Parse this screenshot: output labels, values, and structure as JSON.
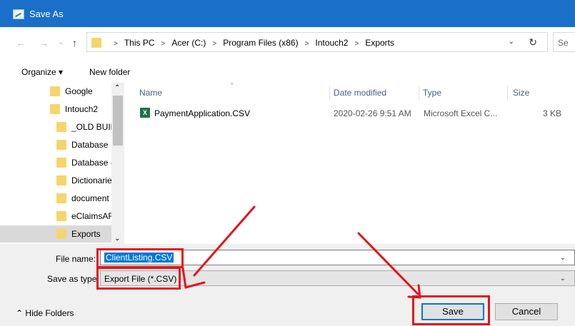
{
  "window": {
    "title": "Save As"
  },
  "address": {
    "crumbs": [
      "This PC",
      "Acer (C:)",
      "Program Files (x86)",
      "Intouch2",
      "Exports"
    ],
    "search_placeholder": "Se"
  },
  "toolbar": {
    "organize_label": "Organize ▾",
    "new_folder_label": "New folder"
  },
  "nav_pane": {
    "items": [
      {
        "label": "Google"
      },
      {
        "label": "Intouch2"
      },
      {
        "label": "_OLD BUIL"
      },
      {
        "label": "Database"
      },
      {
        "label": "Database -"
      },
      {
        "label": "Dictionarie"
      },
      {
        "label": "document"
      },
      {
        "label": "eClaimsAF"
      },
      {
        "label": "Exports"
      }
    ],
    "selected": "Exports"
  },
  "file_list": {
    "columns": [
      "Name",
      "Date modified",
      "Type",
      "Size"
    ],
    "rows": [
      {
        "name": "PaymentApplication.CSV",
        "date": "2020-02-26 9:51 AM",
        "type": "Microsoft Excel C...",
        "size": "3 KB"
      }
    ]
  },
  "bottom": {
    "file_name_label": "File name:",
    "file_name_value": "ClientListing.CSV",
    "save_type_label": "Save as type:",
    "save_type_value": "Export File (*.CSV)",
    "hide_folders_label": "Hide Folders",
    "save_label": "Save",
    "cancel_label": "Cancel"
  },
  "colors": {
    "titlebar": "#1a6fc9",
    "highlight": "#e5141b",
    "selection": "#0078d7"
  },
  "icons": [
    "back-arrow-icon",
    "forward-arrow-icon",
    "chevron-down-icon",
    "up-arrow-icon",
    "folder-icon",
    "refresh-icon",
    "excel-csv-icon"
  ]
}
